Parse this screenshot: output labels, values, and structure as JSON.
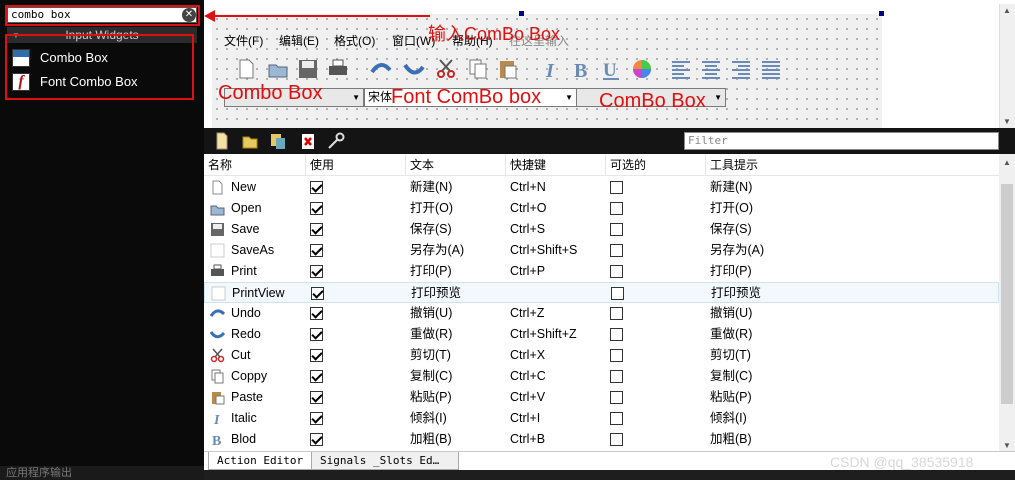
{
  "widget_box": {
    "search_value": "combo box",
    "clear_icon": "clear-icon",
    "category": "Input Widgets",
    "items": [
      {
        "label": "Combo Box",
        "icon": "combo-box-icon"
      },
      {
        "label": "Font Combo Box",
        "icon": "font-combo-box-icon"
      }
    ],
    "bottom_text": "应用程序输出"
  },
  "annotations": {
    "color": "#e01010",
    "input_hint": "输入ComBo Box",
    "combo_box_label": "Combo Box",
    "font_combo_box_label": "Font ComBo box",
    "combo_box_label_2": "ComBo Box"
  },
  "form": {
    "menus": [
      "文件(F)",
      "编辑(E)",
      "格式(O)",
      "窗口(W)",
      "帮助(H)",
      "在这里输入"
    ],
    "toolbar_icons": [
      "new-file-icon",
      "open-folder-icon",
      "save-icon",
      "print-icon",
      "undo-icon",
      "redo-icon",
      "cut-icon",
      "copy-icon",
      "paste-icon",
      "italic-icon",
      "bold-icon",
      "underline-icon",
      "color-wheel-icon",
      "align-left-icon",
      "align-center-icon",
      "align-right-icon",
      "justify-icon"
    ],
    "combos": [
      {
        "value": ""
      },
      {
        "value": "宋体"
      },
      {
        "value": ""
      }
    ]
  },
  "action_editor": {
    "toolbar_icons": [
      "new-action-icon",
      "open-action-icon",
      "copy-action-icon",
      "delete-action-icon",
      "configure-icon"
    ],
    "filter_placeholder": "Filter",
    "columns": [
      "名称",
      "使用",
      "文本",
      "快捷键",
      "可选的",
      "工具提示"
    ],
    "rows": [
      {
        "name": "New",
        "used": true,
        "text": "新建(N)",
        "shortcut": "Ctrl+N",
        "checkable": false,
        "tooltip": "新建(N)",
        "icon": "new-file-icon"
      },
      {
        "name": "Open",
        "used": true,
        "text": "打开(O)",
        "shortcut": "Ctrl+O",
        "checkable": false,
        "tooltip": "打开(O)",
        "icon": "open-folder-icon"
      },
      {
        "name": "Save",
        "used": true,
        "text": "保存(S)",
        "shortcut": "Ctrl+S",
        "checkable": false,
        "tooltip": "保存(S)",
        "icon": "save-icon"
      },
      {
        "name": "SaveAs",
        "used": true,
        "text": "另存为(A)",
        "shortcut": "Ctrl+Shift+S",
        "checkable": false,
        "tooltip": "另存为(A)",
        "icon": "blank-icon"
      },
      {
        "name": "Print",
        "used": true,
        "text": "打印(P)",
        "shortcut": "Ctrl+P",
        "checkable": false,
        "tooltip": "打印(P)",
        "icon": "print-icon"
      },
      {
        "name": "PrintView",
        "used": true,
        "text": "打印预览",
        "shortcut": "",
        "checkable": false,
        "tooltip": "打印预览",
        "icon": "blank-icon"
      },
      {
        "name": "Undo",
        "used": true,
        "text": "撤销(U)",
        "shortcut": "Ctrl+Z",
        "checkable": false,
        "tooltip": "撤销(U)",
        "icon": "undo-icon"
      },
      {
        "name": "Redo",
        "used": true,
        "text": "重做(R)",
        "shortcut": "Ctrl+Shift+Z",
        "checkable": false,
        "tooltip": "重做(R)",
        "icon": "redo-icon"
      },
      {
        "name": "Cut",
        "used": true,
        "text": "剪切(T)",
        "shortcut": "Ctrl+X",
        "checkable": false,
        "tooltip": "剪切(T)",
        "icon": "cut-icon"
      },
      {
        "name": "Coppy",
        "used": true,
        "text": "复制(C)",
        "shortcut": "Ctrl+C",
        "checkable": false,
        "tooltip": "复制(C)",
        "icon": "copy-icon"
      },
      {
        "name": "Paste",
        "used": true,
        "text": "粘贴(P)",
        "shortcut": "Ctrl+V",
        "checkable": false,
        "tooltip": "粘贴(P)",
        "icon": "paste-icon"
      },
      {
        "name": "Italic",
        "used": true,
        "text": "倾斜(I)",
        "shortcut": "Ctrl+I",
        "checkable": false,
        "tooltip": "倾斜(I)",
        "icon": "italic-icon"
      },
      {
        "name": "Blod",
        "used": true,
        "text": "加粗(B)",
        "shortcut": "Ctrl+B",
        "checkable": false,
        "tooltip": "加粗(B)",
        "icon": "bold-icon"
      }
    ],
    "selected_row": "PrintView",
    "tabs": [
      "Action Editor",
      "Signals _Slots Ed…"
    ]
  },
  "watermark": "CSDN @qq_38535918"
}
